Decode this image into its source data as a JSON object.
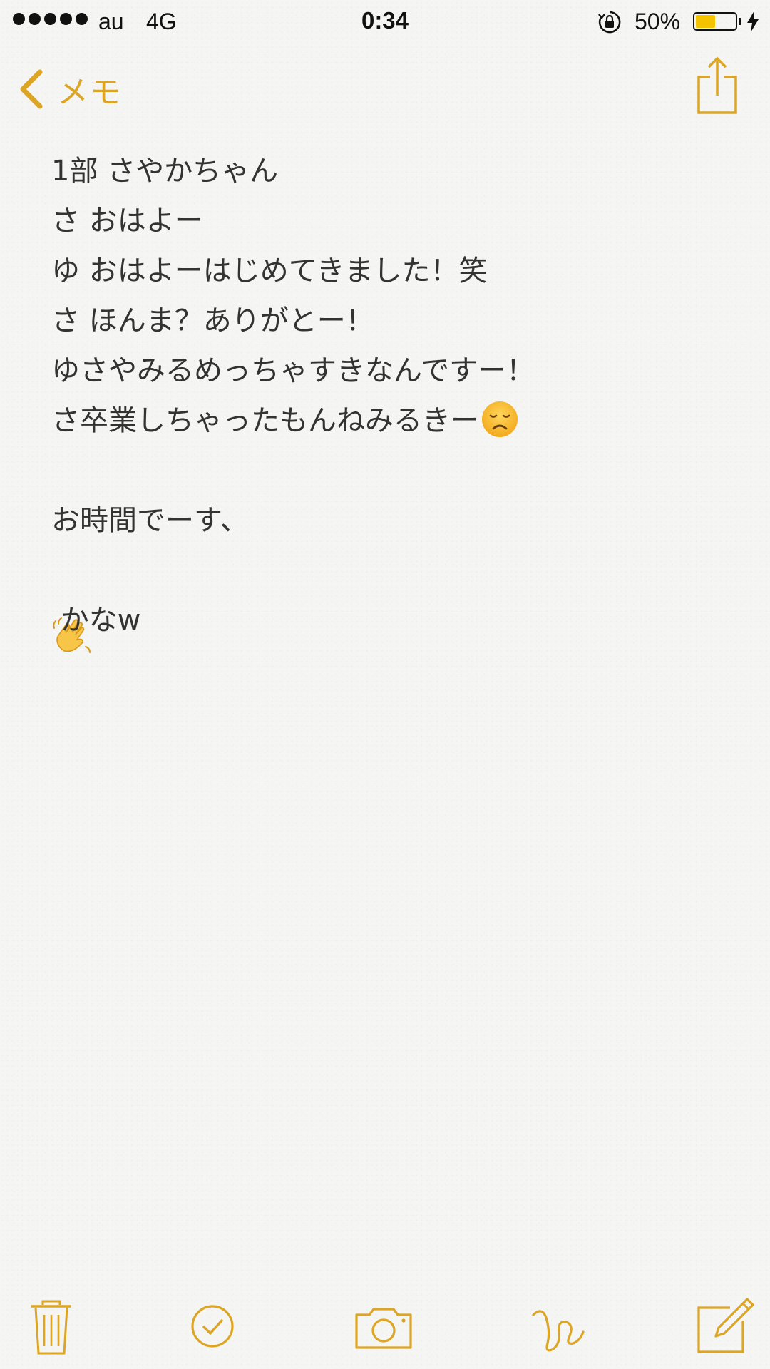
{
  "status_bar": {
    "carrier": "au",
    "network": "4G",
    "time": "0:34",
    "battery_percent_label": "50%",
    "battery_level": 0.5
  },
  "nav": {
    "back_label": "メモ"
  },
  "note": {
    "lines": [
      "1部 さやかちゃん",
      "さ おはよー",
      "ゆ おはよーはじめてきました！笑",
      "さ ほんま？ありがとー！",
      "ゆさやみるめっちゃすきなんですー！",
      "さ卒業しちゃったもんねみるきー",
      "",
      "お時間でーす、",
      " かなw"
    ]
  },
  "icons": {
    "accent": "#dca524",
    "disappointed_emoji": "disappointed-face-icon",
    "wave_emoji": "waving-hand-icon"
  },
  "toolbar": {
    "items": [
      "trash-icon",
      "checklist-icon",
      "camera-icon",
      "sketch-icon",
      "compose-icon"
    ]
  }
}
